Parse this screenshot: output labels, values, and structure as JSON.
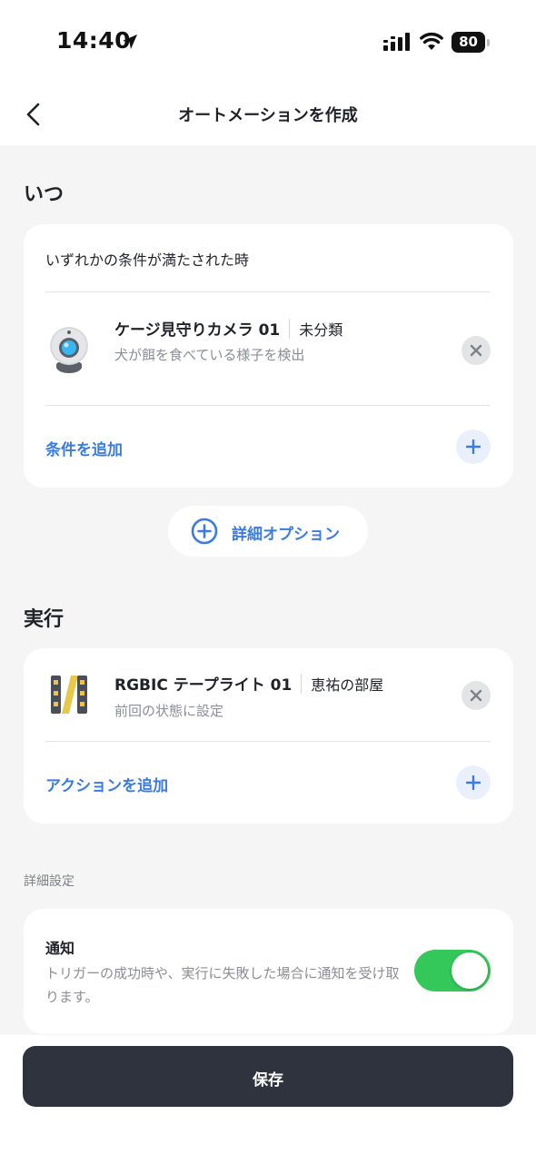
{
  "status_bar": {
    "time": "14:40",
    "battery": "80"
  },
  "header": {
    "title": "オートメーションを作成"
  },
  "when": {
    "section_title": "いつ",
    "condition_header": "いずれかの条件が満たされた時",
    "item": {
      "title": "ケージ見守りカメラ 01",
      "room": "未分類",
      "subtitle": "犬が餌を食べている様子を検出",
      "icon": "camera-icon"
    },
    "add_label": "条件を追加"
  },
  "detail_options_label": "詳細オプション",
  "execute": {
    "section_title": "実行",
    "item": {
      "title": "RGBIC テープライト 01",
      "room": "恵祐の部屋",
      "subtitle": "前回の状態に設定",
      "icon": "led-strip-icon"
    },
    "add_label": "アクションを追加"
  },
  "advanced": {
    "section_label": "詳細設定",
    "notification": {
      "title": "通知",
      "description": "トリガーの成功時や、実行に失敗した場合に通知を受け取ります。",
      "enabled": true
    }
  },
  "save_label": "保存",
  "colors": {
    "accent": "#3a7be0",
    "toggle_on": "#34c759",
    "save_button": "#2f333d",
    "background": "#f5f5f5"
  }
}
